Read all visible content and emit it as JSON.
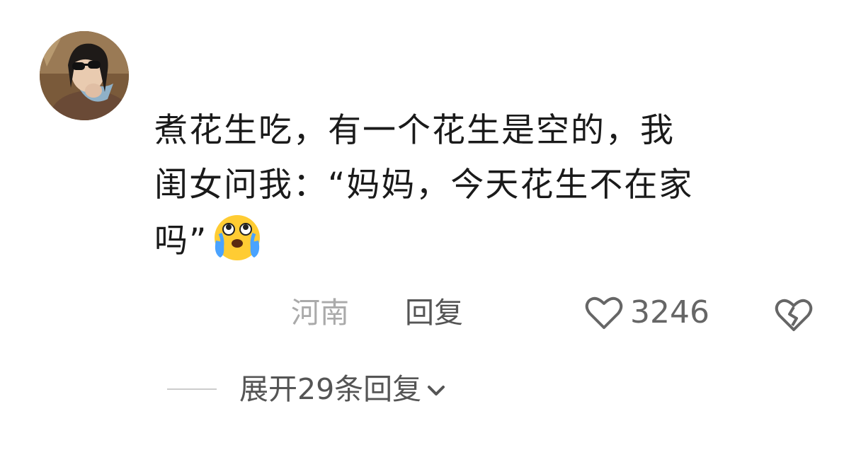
{
  "comment": {
    "lines": [
      "煮花生吃，有一个花生是空的，我",
      "闺女问我：“妈妈，今天花生不在家",
      "吗”"
    ]
  },
  "emoji": "crying-face-emoji",
  "meta": {
    "location": "河南",
    "reply_label": "回复",
    "like_count": "3246"
  },
  "expand": {
    "label": "展开29条回复"
  },
  "icons": {
    "like": "heart-outline-icon",
    "dislike": "broken-heart-icon",
    "expand": "chevron-down-icon"
  },
  "colors": {
    "text": "#1a1a1a",
    "muted": "#aaaaaa",
    "secondary": "#555555",
    "emoji_face": "#ffcc33",
    "emoji_tears": "#4aa3ff"
  }
}
